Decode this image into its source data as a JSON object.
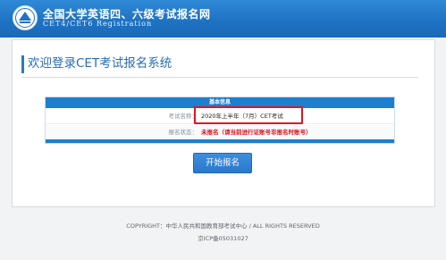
{
  "header": {
    "title_cn": "全国大学英语四、六级考试报名网",
    "title_en": "CET4/CET6  Registration",
    "logo_icon": "cet-emblem-icon"
  },
  "main": {
    "page_title": "欢迎登录CET考试报名系统",
    "panel": {
      "heading": "基本信息",
      "rows": [
        {
          "label": "考试名称：",
          "value": "2020年上半年（7月）CET考试"
        },
        {
          "label": "报名状态：",
          "value": "未报名（请当前进行证账号非报名时账号）"
        }
      ]
    },
    "start_button_label": "开始报名"
  },
  "footer": {
    "copyright": "COPYRIGHT：中华人民共和国教育部考试中心 / ALL RIGHTS RESERVED",
    "icp": "京ICP备05031027"
  },
  "colors": {
    "header_blue": "#1f73c4",
    "accent_blue": "#1d7fd0",
    "highlight_red": "#e0151e",
    "status_red": "#e0101b"
  }
}
